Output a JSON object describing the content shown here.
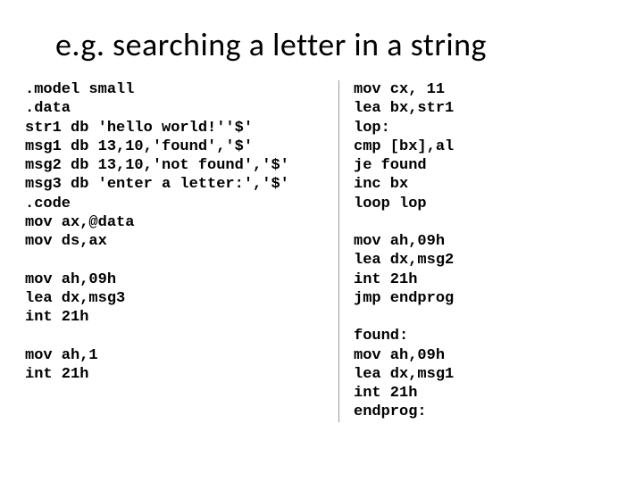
{
  "title": "e.g. searching a letter in a string",
  "code_left": ".model small\n.data\nstr1 db 'hello world!''$'\nmsg1 db 13,10,'found','$'\nmsg2 db 13,10,'not found','$'\nmsg3 db 'enter a letter:','$'\n.code\nmov ax,@data\nmov ds,ax\n\nmov ah,09h\nlea dx,msg3\nint 21h\n\nmov ah,1\nint 21h",
  "code_right": "mov cx, 11\nlea bx,str1\nlop:\ncmp [bx],al\nje found\ninc bx\nloop lop\n\nmov ah,09h\nlea dx,msg2\nint 21h\njmp endprog\n\nfound:\nmov ah,09h\nlea dx,msg1\nint 21h\nendprog:"
}
